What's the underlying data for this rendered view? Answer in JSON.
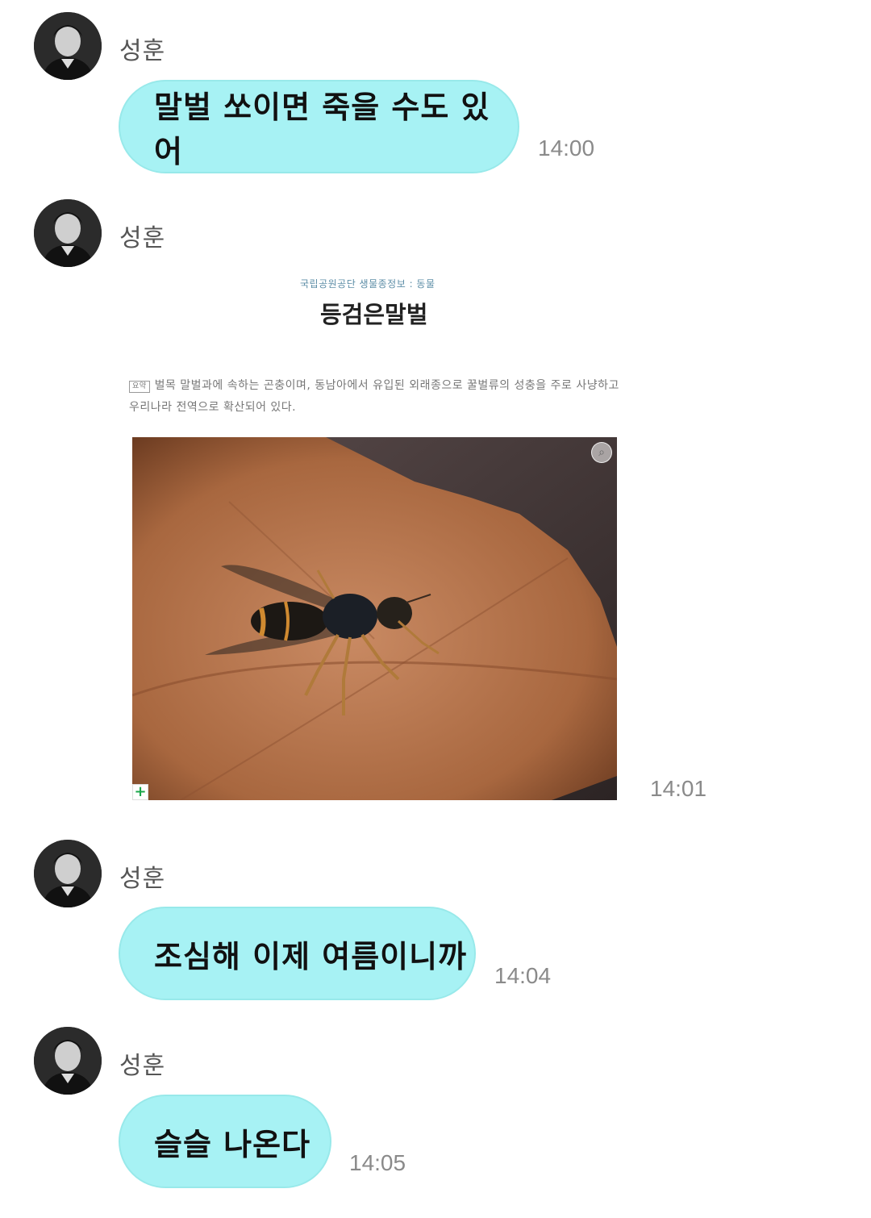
{
  "messages": [
    {
      "sender": "성훈",
      "text": "말벌 쏘이면 죽을 수도 있어",
      "time": "14:00"
    },
    {
      "sender": "성훈",
      "type": "shared-card",
      "time": "14:01",
      "card": {
        "source": "국립공원공단 생물종정보 : 동물",
        "title": "등검은말벌",
        "summary_tag": "요약",
        "summary": "벌목 말벌과에 속하는 곤충이며, 동남아에서 유입된 외래종으로 꿀벌류의 성충을 주로 사냥하고 우리나라 전역으로 확산되어 있다."
      }
    },
    {
      "sender": "성훈",
      "text": "조심해 이제 여름이니까",
      "time": "14:04"
    },
    {
      "sender": "성훈",
      "text": "슬슬 나온다",
      "time": "14:05"
    }
  ],
  "icons": {
    "avatar": "person-portrait",
    "expand": "plus-icon",
    "lens": "image-search-icon"
  },
  "colors": {
    "bubble": "#a7f2f4",
    "time": "#8a8a8a",
    "sender": "#555555"
  }
}
